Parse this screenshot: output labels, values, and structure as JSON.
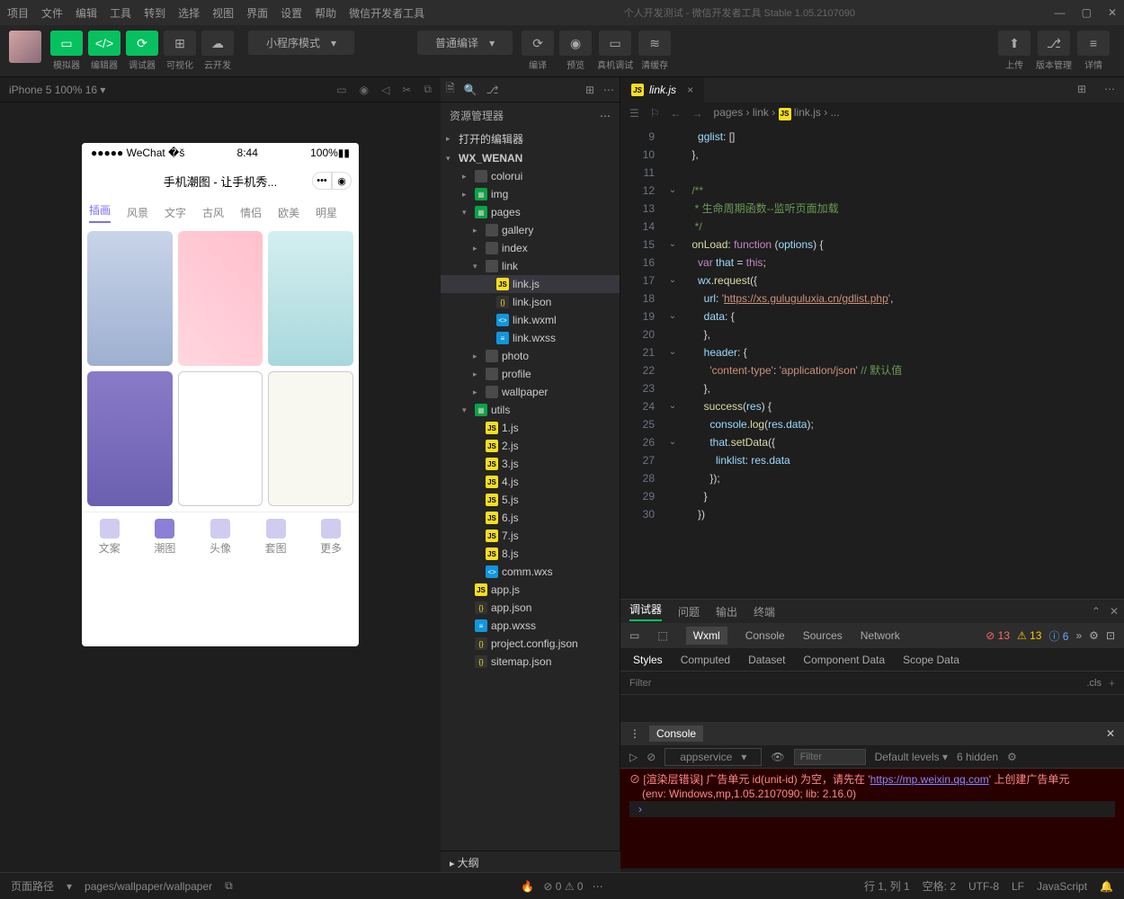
{
  "titlebar": {
    "menus": [
      "项目",
      "文件",
      "编辑",
      "工具",
      "转到",
      "选择",
      "视图",
      "界面",
      "设置",
      "帮助",
      "微信开发者工具"
    ],
    "title": "个人开发测试 - 微信开发者工具 Stable 1.05.2107090"
  },
  "toolbar": {
    "sim": "模拟器",
    "editor": "编辑器",
    "debug": "调试器",
    "visual": "可视化",
    "cloud": "云开发",
    "mode": "小程序模式",
    "compile_mode": "普通编译",
    "compile": "编译",
    "preview": "预览",
    "remote": "真机调试",
    "clear": "清缓存",
    "upload": "上传",
    "version": "版本管理",
    "detail": "详情"
  },
  "simulator": {
    "device": "iPhone 5 100% 16",
    "carrier": "WeChat",
    "time": "8:44",
    "battery": "100%",
    "app_title": "手机潮图 - 让手机秀...",
    "tabs": [
      "插画",
      "风景",
      "文字",
      "古风",
      "情侣",
      "欧美",
      "明星"
    ],
    "bottom": [
      "文案",
      "潮图",
      "头像",
      "套图",
      "更多"
    ]
  },
  "explorer": {
    "title": "资源管理器",
    "opened": "打开的编辑器",
    "project": "WX_WENAN",
    "outline": "大纲",
    "tree": [
      {
        "n": "colorui",
        "t": "folder",
        "d": 2
      },
      {
        "n": "img",
        "t": "img",
        "d": 2
      },
      {
        "n": "pages",
        "t": "page",
        "d": 2,
        "open": true
      },
      {
        "n": "gallery",
        "t": "folder",
        "d": 3
      },
      {
        "n": "index",
        "t": "folder",
        "d": 3
      },
      {
        "n": "link",
        "t": "folder",
        "d": 3,
        "open": true
      },
      {
        "n": "link.js",
        "t": "js",
        "d": 4,
        "sel": true
      },
      {
        "n": "link.json",
        "t": "json",
        "d": 4
      },
      {
        "n": "link.wxml",
        "t": "wxml",
        "d": 4
      },
      {
        "n": "link.wxss",
        "t": "wxss",
        "d": 4
      },
      {
        "n": "photo",
        "t": "folder",
        "d": 3
      },
      {
        "n": "profile",
        "t": "folder",
        "d": 3
      },
      {
        "n": "wallpaper",
        "t": "folder",
        "d": 3
      },
      {
        "n": "utils",
        "t": "page",
        "d": 2,
        "open": true
      },
      {
        "n": "1.js",
        "t": "js",
        "d": 3
      },
      {
        "n": "2.js",
        "t": "js",
        "d": 3
      },
      {
        "n": "3.js",
        "t": "js",
        "d": 3
      },
      {
        "n": "4.js",
        "t": "js",
        "d": 3
      },
      {
        "n": "5.js",
        "t": "js",
        "d": 3
      },
      {
        "n": "6.js",
        "t": "js",
        "d": 3
      },
      {
        "n": "7.js",
        "t": "js",
        "d": 3
      },
      {
        "n": "8.js",
        "t": "js",
        "d": 3
      },
      {
        "n": "comm.wxs",
        "t": "wxml",
        "d": 3
      },
      {
        "n": "app.js",
        "t": "js",
        "d": 2
      },
      {
        "n": "app.json",
        "t": "json",
        "d": 2
      },
      {
        "n": "app.wxss",
        "t": "wxss",
        "d": 2
      },
      {
        "n": "project.config.json",
        "t": "json",
        "d": 2
      },
      {
        "n": "sitemap.json",
        "t": "json",
        "d": 2
      }
    ]
  },
  "editor": {
    "tab": "link.js",
    "breadcrumb": [
      "pages",
      "link",
      "link.js",
      "..."
    ],
    "lines": [
      {
        "n": 9,
        "h": "      <span class='tk-prop'>gglist</span><span class='tk-pun'>: []</span>"
      },
      {
        "n": 10,
        "h": "    <span class='tk-pun'>},</span>"
      },
      {
        "n": 11,
        "h": ""
      },
      {
        "n": 12,
        "h": "    <span class='tk-com'>/**</span>",
        "f": "⌄"
      },
      {
        "n": 13,
        "h": "    <span class='tk-com'> * 生命周期函数--监听页面加载</span>"
      },
      {
        "n": 14,
        "h": "    <span class='tk-com'> */</span>"
      },
      {
        "n": 15,
        "h": "    <span class='tk-fn'>onLoad</span><span class='tk-pun'>: </span><span class='tk-kw'>function</span> <span class='tk-pun'>(</span><span class='tk-var'>options</span><span class='tk-pun'>) {</span>",
        "f": "⌄"
      },
      {
        "n": 16,
        "h": "      <span class='tk-kw'>var</span> <span class='tk-var'>that</span> <span class='tk-pun'>=</span> <span class='tk-kw'>this</span><span class='tk-pun'>;</span>"
      },
      {
        "n": 17,
        "h": "      <span class='tk-var'>wx</span><span class='tk-pun'>.</span><span class='tk-fn'>request</span><span class='tk-pun'>({</span>",
        "f": "⌄"
      },
      {
        "n": 18,
        "h": "        <span class='tk-prop'>url</span><span class='tk-pun'>: </span><span class='tk-str'>'</span><span class='tk-str-u'>https://xs.guluguluxia.cn/gdlist.php</span><span class='tk-str'>'</span><span class='tk-pun'>,</span>"
      },
      {
        "n": 19,
        "h": "        <span class='tk-prop'>data</span><span class='tk-pun'>: {</span>",
        "f": "⌄"
      },
      {
        "n": 20,
        "h": "        <span class='tk-pun'>},</span>"
      },
      {
        "n": 21,
        "h": "        <span class='tk-prop'>header</span><span class='tk-pun'>: {</span>",
        "f": "⌄"
      },
      {
        "n": 22,
        "h": "          <span class='tk-str'>'content-type'</span><span class='tk-pun'>: </span><span class='tk-str'>'application/json'</span> <span class='tk-com'>// 默认值</span>"
      },
      {
        "n": 23,
        "h": "        <span class='tk-pun'>},</span>"
      },
      {
        "n": 24,
        "h": "        <span class='tk-fn'>success</span><span class='tk-pun'>(</span><span class='tk-var'>res</span><span class='tk-pun'>) {</span>",
        "f": "⌄"
      },
      {
        "n": 25,
        "h": "          <span class='tk-var'>console</span><span class='tk-pun'>.</span><span class='tk-fn'>log</span><span class='tk-pun'>(</span><span class='tk-var'>res</span><span class='tk-pun'>.</span><span class='tk-var'>data</span><span class='tk-pun'>);</span>"
      },
      {
        "n": 26,
        "h": "          <span class='tk-var'>that</span><span class='tk-pun'>.</span><span class='tk-fn'>setData</span><span class='tk-pun'>({</span>",
        "f": "⌄"
      },
      {
        "n": 27,
        "h": "            <span class='tk-prop'>linklist</span><span class='tk-pun'>: </span><span class='tk-var'>res</span><span class='tk-pun'>.</span><span class='tk-var'>data</span>"
      },
      {
        "n": 28,
        "h": "          <span class='tk-pun'>});</span>"
      },
      {
        "n": 29,
        "h": "        <span class='tk-pun'>}</span>"
      },
      {
        "n": 30,
        "h": "      <span class='tk-pun'>})</span>"
      }
    ]
  },
  "devtools": {
    "top_tabs": [
      "调试器",
      "问题",
      "输出",
      "终端"
    ],
    "panels": [
      "Wxml",
      "Console",
      "Sources",
      "Network"
    ],
    "err_count": "13",
    "warn_count": "13",
    "info_count": "6",
    "style_tabs": [
      "Styles",
      "Computed",
      "Dataset",
      "Component Data",
      "Scope Data"
    ],
    "filter_ph": "Filter",
    "cls": ".cls",
    "console": "Console",
    "context": "appservice",
    "levels": "Default levels",
    "hidden": "6 hidden",
    "err1": "[渲染层错误] 广告单元 id(unit-id) 为空，请先在 '",
    "err1b": "' 上创建广告单元",
    "err_link": "https://mp.weixin.qq.com",
    "err2": "(env: Windows,mp,1.05.2107090; lib: 2.16.0)"
  },
  "statusbar": {
    "route_lbl": "页面路径",
    "route": "pages/wallpaper/wallpaper",
    "err": "0",
    "warn": "0",
    "line": "行 1, 列 1",
    "spaces": "空格: 2",
    "enc": "UTF-8",
    "eol": "LF",
    "lang": "JavaScript"
  }
}
